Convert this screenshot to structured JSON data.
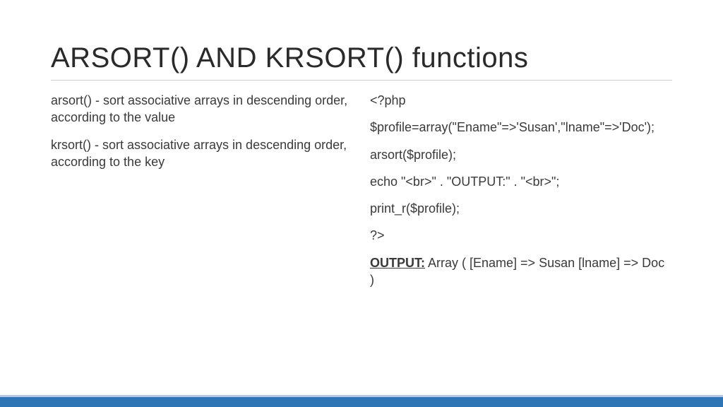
{
  "title": "ARSORT() AND KRSORT() functions",
  "left": {
    "p1": "arsort() - sort associative arrays in descending order, according to the value",
    "p2": " krsort() - sort associative arrays in descending order, according to the key"
  },
  "right": {
    "l1": "<?php",
    "l2": "$profile=array(\"Ename\"=>'Susan',\"lname\"=>'Doc');",
    "l3": "arsort($profile);",
    "l4": "echo \"<br>\" . \"OUTPUT:\" . \"<br>\";",
    "l5": "print_r($profile);",
    "l6": "?>",
    "outLabel": "OUTPUT:",
    "outValue": " Array ( [Ename] => Susan [lname] => Doc )"
  }
}
